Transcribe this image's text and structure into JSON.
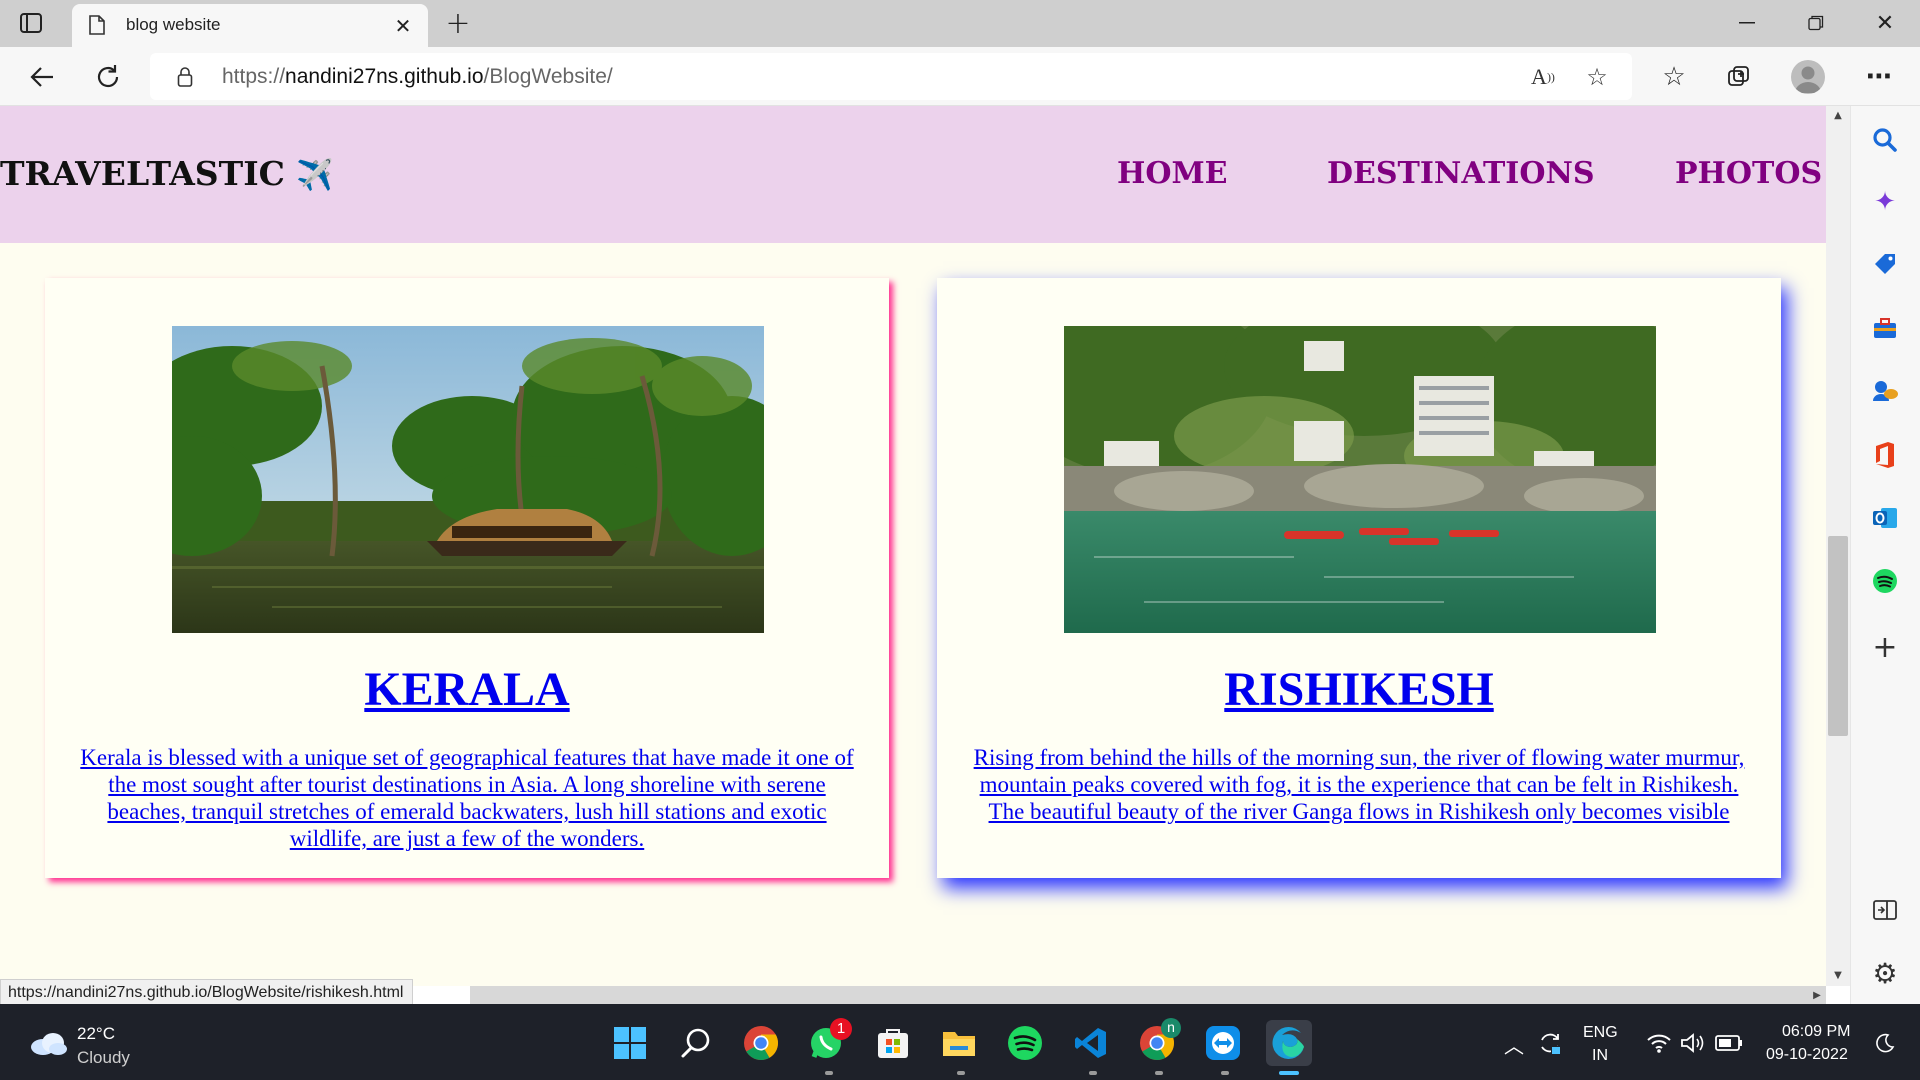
{
  "browser": {
    "tab_title": "blog website",
    "url_prefix": "https://",
    "url_host": "nandini27ns.github.io",
    "url_path": "/BlogWebsite/",
    "status_url": "https://nandini27ns.github.io/BlogWebsite/rishikesh.html",
    "icons": [
      "tab-actions-icon",
      "page-icon",
      "close-tab-icon",
      "new-tab-icon",
      "minimize-icon",
      "restore-icon",
      "window-close-icon",
      "back-icon",
      "refresh-icon",
      "lock-icon",
      "read-aloud-icon",
      "add-favorite-icon",
      "favorites-icon",
      "collections-icon",
      "profile-icon",
      "more-icon"
    ]
  },
  "site": {
    "logo": "TRAVELTASTIC",
    "logo_emoji": "✈️",
    "nav": [
      "HOME",
      "DESTINATIONS",
      "PHOTOS"
    ]
  },
  "cards": [
    {
      "title": "KERALA",
      "text": "Kerala is blessed with a unique set of geographical features that have made it one of the most sought after tourist destinations in Asia. A long shoreline with serene beaches, tranquil stretches of emerald backwaters, lush hill stations and exotic wildlife, are just a few of the wonders.",
      "shadow_color": "#ff2f8f"
    },
    {
      "title": "RISHIKESH",
      "text": "Rising from behind the hills of the morning sun, the river of flowing water murmur, mountain peaks covered with fog, it is the experience that can be felt in Rishikesh. The beautiful beauty of the river Ganga flows in Rishikesh only becomes visible",
      "shadow_color": "#2a35ff"
    }
  ],
  "sidebar_icons": [
    "search-icon",
    "copilot-icon",
    "shopping-icon",
    "tools-icon",
    "games-icon",
    "office-icon",
    "outlook-icon",
    "spotify-icon",
    "add-icon",
    "split-screen-icon",
    "settings-icon"
  ],
  "taskbar": {
    "weather_temp": "22°C",
    "weather_desc": "Cloudy",
    "whatsapp_badge": "1",
    "chrome_profile_badge": "n",
    "lang_top": "ENG",
    "lang_bottom": "IN",
    "time": "06:09 PM",
    "date": "09-10-2022",
    "apps": [
      "windows-start-icon",
      "search-icon",
      "chrome-icon",
      "whatsapp-icon",
      "store-icon",
      "file-explorer-icon",
      "spotify-icon",
      "vscode-icon",
      "chrome-profile-icon",
      "teamviewer-icon",
      "edge-icon"
    ]
  },
  "colors": {
    "header_bg": "#ecd2ec",
    "nav_color": "#800080",
    "page_bg": "#fefdf0",
    "link_color": "#0000ee"
  }
}
